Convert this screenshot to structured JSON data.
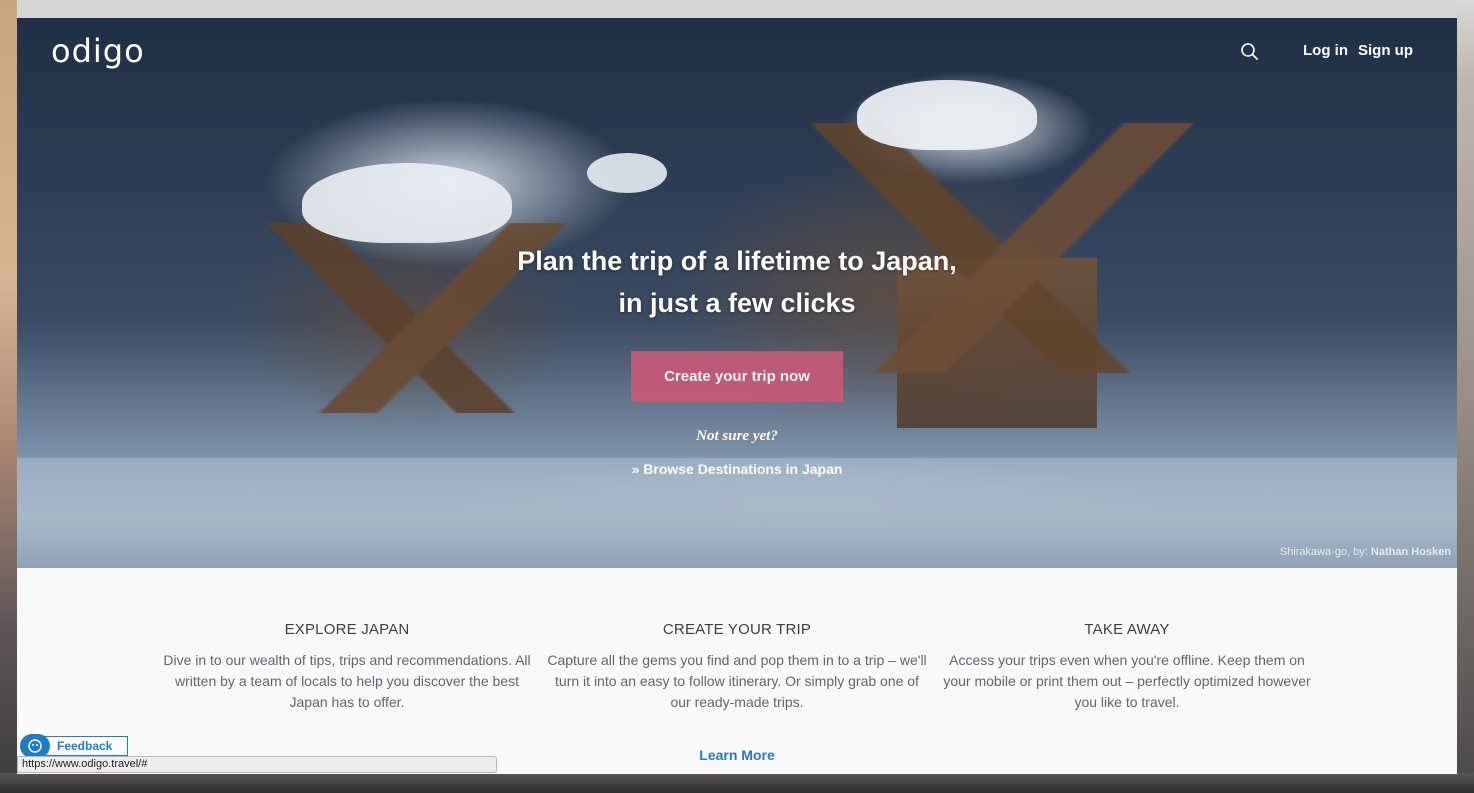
{
  "header": {
    "logo": "odigo",
    "search_icon": "search-icon",
    "login_label": "Log in",
    "signup_label": "Sign up"
  },
  "hero": {
    "title_line1": "Plan the trip of a lifetime to Japan,",
    "title_line2": "in just a few clicks",
    "cta_label": "Create your trip now",
    "not_sure": "Not sure yet?",
    "browse_link": "» Browse Destinations in Japan",
    "photo_credit_place": "Shirakawa-go, by:",
    "photo_credit_author": "Nathan Hosken"
  },
  "features": [
    {
      "title": "EXPLORE JAPAN",
      "text": "Dive in to our wealth of tips, trips and recommendations. All written by a team of locals to help you discover the best Japan has to offer."
    },
    {
      "title": "CREATE YOUR TRIP",
      "text": "Capture all the gems you find and pop them in to a trip – we'll turn it into an easy to follow itinerary. Or simply grab one of our ready-made trips."
    },
    {
      "title": "TAKE AWAY",
      "text": "Access your trips even when you're offline. Keep them on your mobile or print them out – perfectly optimized however you like to travel."
    }
  ],
  "learn_more": "Learn More",
  "feedback_label": "Feedback",
  "status_url": "https://www.odigo.travel/#",
  "colors": {
    "cta": "#c65a78",
    "link": "#2a7ab8",
    "feedback": "#1f7cc2"
  }
}
